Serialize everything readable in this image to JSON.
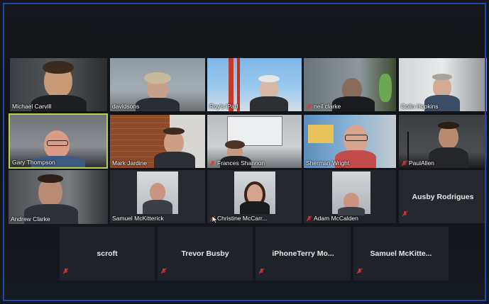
{
  "participants_row1": [
    {
      "name": "Michael Carvill",
      "muted": false
    },
    {
      "name": "davidsons",
      "muted": false
    },
    {
      "name": "Roy's iPad",
      "muted": false
    },
    {
      "name": "neil.clarke",
      "muted": true
    },
    {
      "name": "Colin Hopkins",
      "muted": false
    }
  ],
  "participants_row2": [
    {
      "name": "Gary Thompson",
      "muted": false,
      "active": true
    },
    {
      "name": "Mark Jardine",
      "muted": false
    },
    {
      "name": "Frances Shannon",
      "muted": true
    },
    {
      "name": "Sherman Wright",
      "muted": false
    },
    {
      "name": "PaulAllen",
      "muted": true
    }
  ],
  "participants_row3": [
    {
      "name": "Andrew Clarke",
      "muted": false
    },
    {
      "name": "Samuel McKitterick",
      "muted": false
    },
    {
      "name": "Christine McCarr...",
      "muted": true
    },
    {
      "name": "Adam McCalden",
      "muted": true
    },
    {
      "name": "Ausby Rodrigues",
      "muted": true,
      "video": false
    }
  ],
  "participants_row4": [
    {
      "name": "scroft",
      "muted": true
    },
    {
      "name": "Trevor Busby",
      "muted": true
    },
    {
      "name": "iPhoneTerry  Mo...",
      "muted": true
    },
    {
      "name": "Samuel  McKitte...",
      "muted": true
    }
  ],
  "colors": {
    "accent_border": "#2346a8",
    "active_speaker": "#b6d24a",
    "muted_mic": "#e0362c"
  }
}
